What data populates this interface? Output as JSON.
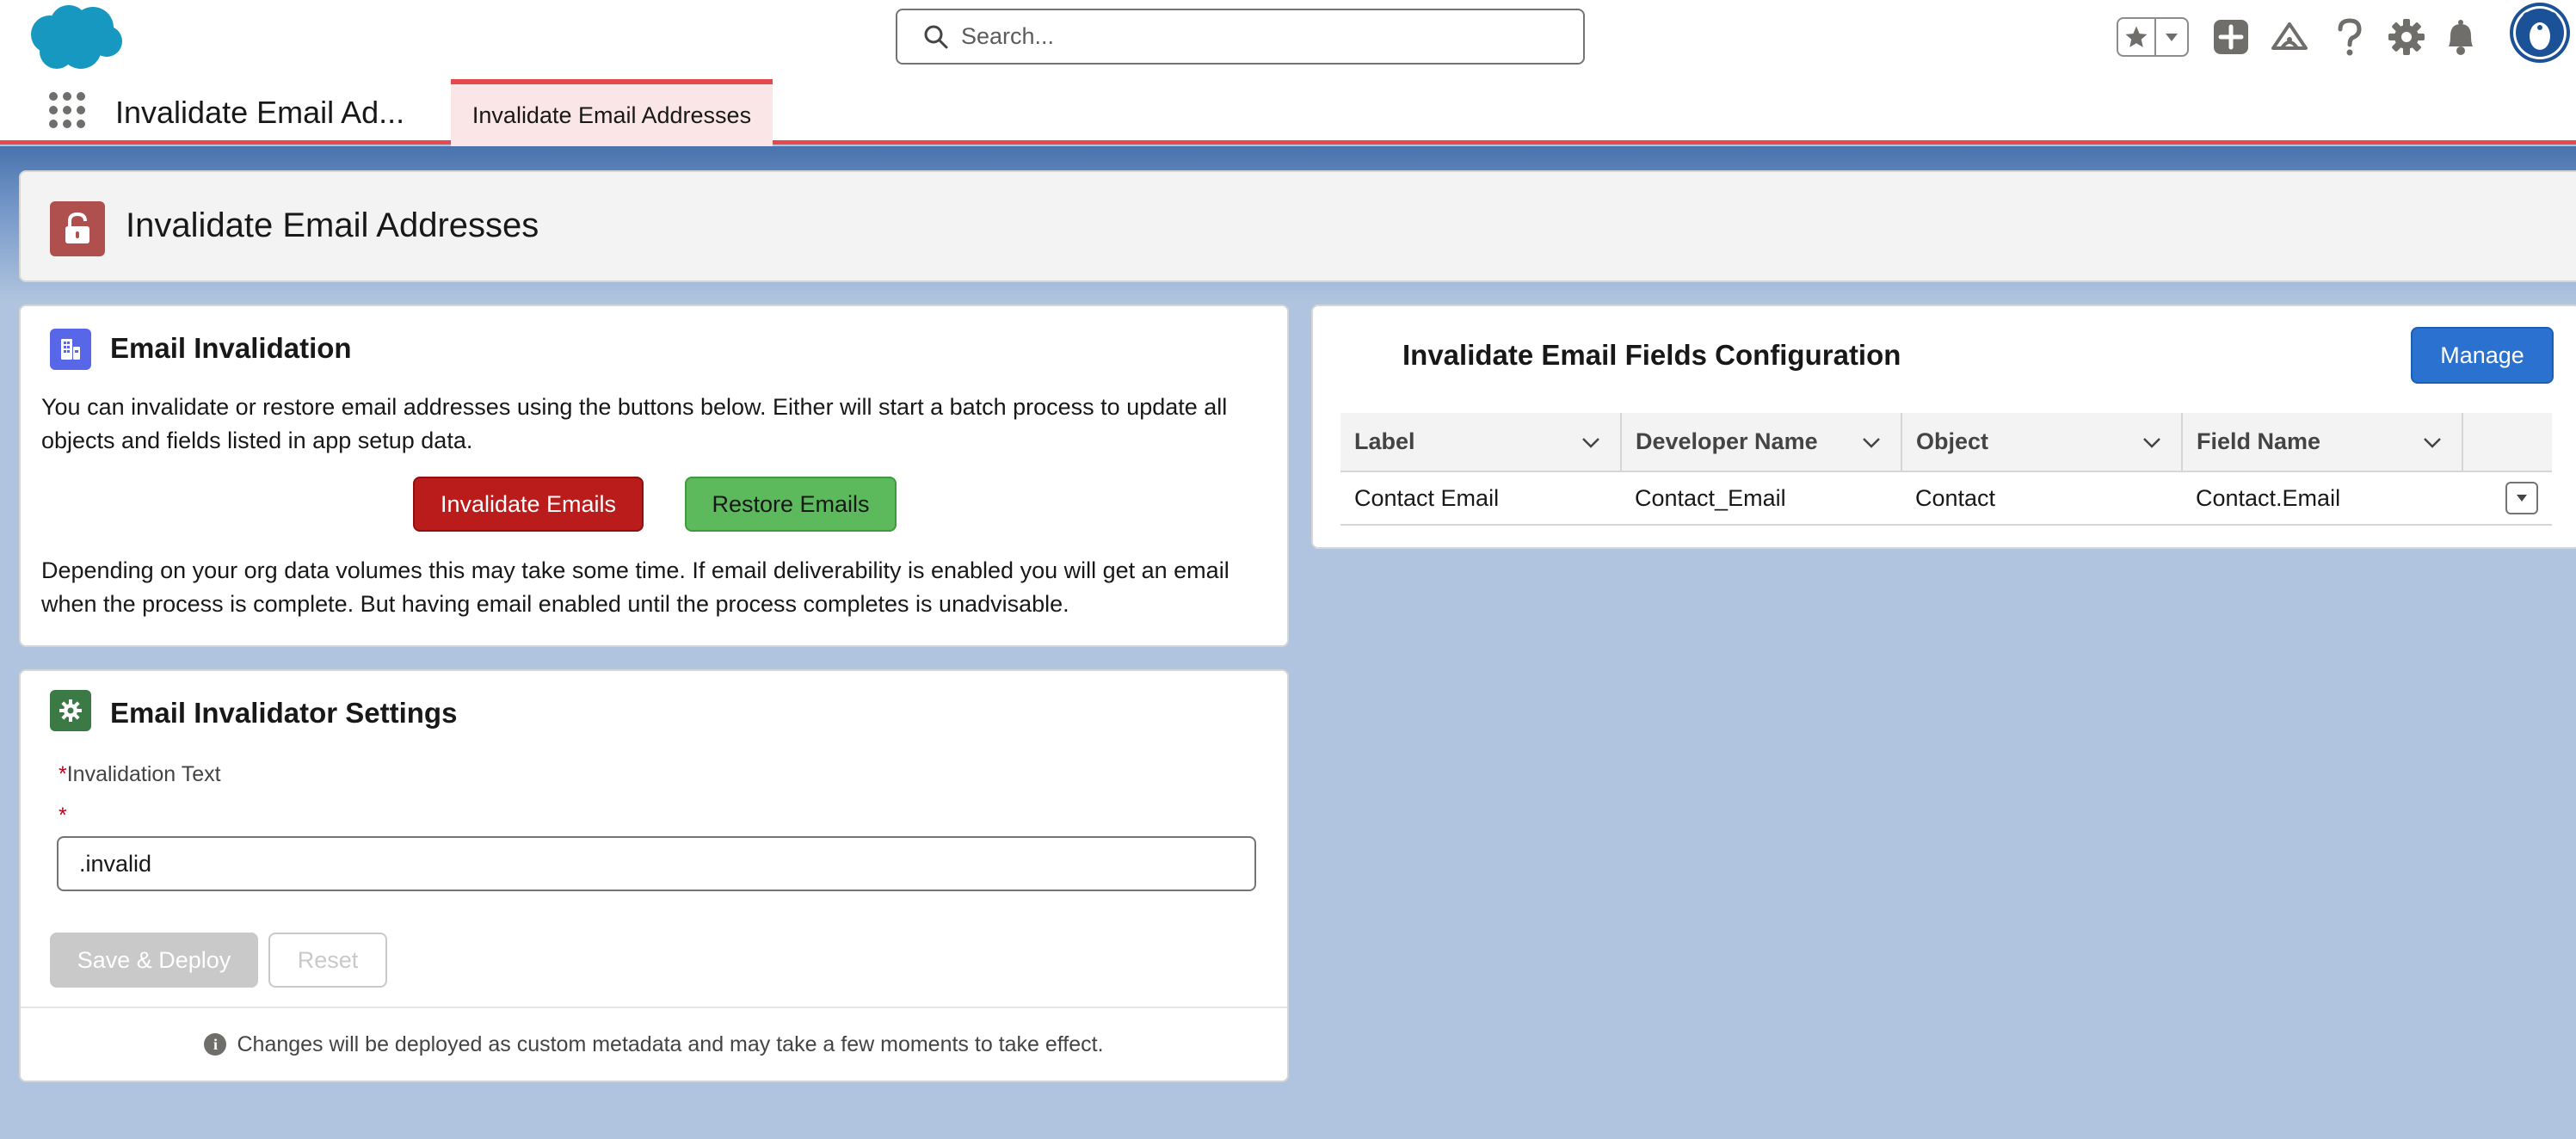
{
  "header": {
    "search_placeholder": "Search...",
    "icons": [
      "salesforce-cloud-logo",
      "search-icon",
      "favorites-star-icon",
      "favorites-dropdown-icon",
      "global-actions-add-icon",
      "trailhead-icon",
      "help-icon",
      "setup-gear-icon",
      "notifications-bell-icon",
      "user-avatar"
    ]
  },
  "app_nav": {
    "app_name": "Invalidate Email Ad...",
    "active_tab": "Invalidate Email Addresses"
  },
  "page_header": {
    "title": "Invalidate Email Addresses"
  },
  "email_invalidation": {
    "title": "Email Invalidation",
    "description": "You can invalidate or restore email addresses using the buttons below. Either will start a batch process to update all objects and fields listed in app setup data.",
    "invalidate_label": "Invalidate Emails",
    "restore_label": "Restore Emails",
    "note": "Depending on your org data volumes this may take some time. If email deliverability is enabled you will get an email when the process is complete. But having email enabled until the process completes is unadvisable."
  },
  "settings": {
    "title": "Email Invalidator Settings",
    "required_mark": "*",
    "field_label": "Invalidation Text",
    "field_value": ".invalid",
    "save_label": "Save & Deploy",
    "reset_label": "Reset",
    "footer_text": "Changes will be deployed as custom metadata and may take a few moments to take effect.",
    "info_glyph": "i"
  },
  "fields_config": {
    "title": "Invalidate Email Fields Configuration",
    "manage_label": "Manage",
    "columns": [
      "Label",
      "Developer Name",
      "Object",
      "Field Name"
    ],
    "rows": [
      {
        "label": "Contact Email",
        "developer_name": "Contact_Email",
        "object": "Contact",
        "field_name": "Contact.Email"
      }
    ]
  },
  "colors": {
    "brand": "#2b72d0",
    "danger": "#ba1b1b",
    "success": "#5cba5c",
    "tab_accent": "#e5484d",
    "page_icon": "#b0504e",
    "settings_icon": "#3b7a45",
    "invalidation_icon": "#5867e8"
  }
}
